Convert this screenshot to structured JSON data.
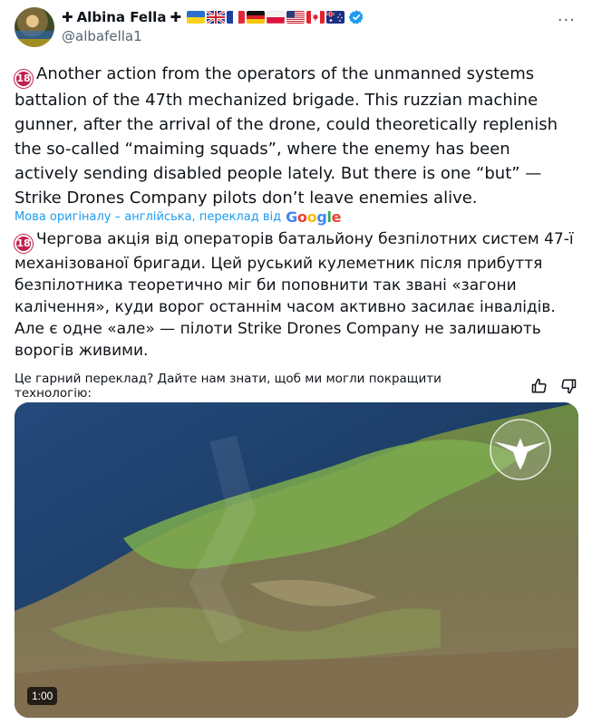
{
  "author": {
    "name": "Albina Fella",
    "handle": "@albafella1",
    "flags": [
      "ukraine",
      "uk",
      "france",
      "germany",
      "poland",
      "usa",
      "canada",
      "australia"
    ]
  },
  "more_label": "···",
  "post": {
    "age_badge": "18",
    "text_en": "Another action from the operators of the unmanned systems battalion of the 47th mechanized brigade. This ruzzian machine gunner, after the arrival of the drone, could theoretically replenish the so-called “maiming squads”, where the enemy has been actively sending disabled people lately. But there is one “but” — Strike Drones Company pilots don’t leave enemies alive.",
    "translation_note": "Мова оригіналу – англійська, переклад від",
    "translation_provider": "Google",
    "text_uk": "Чергова акція від операторів батальйону безпілотних систем 47-ї механізованої бригади. Цей руський кулеметник після прибуття безпілотника теоретично міг би поповнити так звані «загони калічення», куди ворог останнім часом активно засилає інвалідів. Але є одне «але» — пілоти Strike Drones Company не залишають ворогів живими."
  },
  "feedback": {
    "prompt": "Це гарний переклад? Дайте нам знати, щоб ми могли покращити технологію:"
  },
  "video": {
    "duration": "1:00"
  },
  "colors": {
    "link": "#1d9bf0",
    "secondary_text": "#536471",
    "badge": "#c01f4d"
  }
}
